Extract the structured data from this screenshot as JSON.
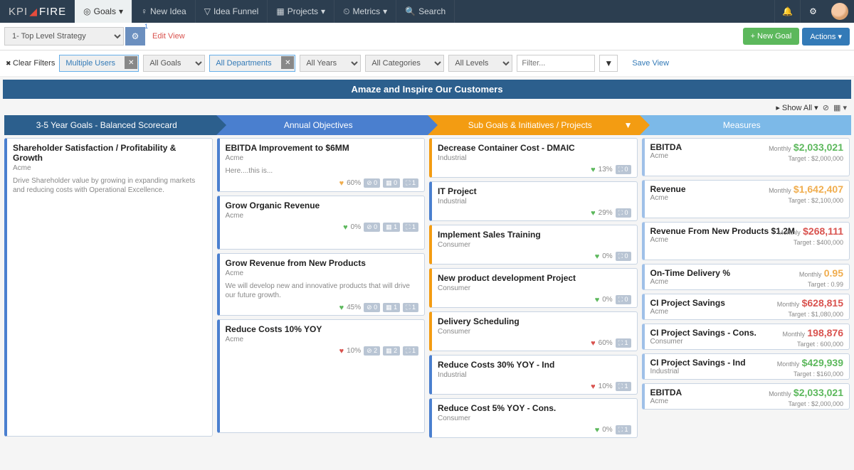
{
  "nav": {
    "logo_a": "KPI",
    "logo_b": "FIRE",
    "items": [
      {
        "label": "Goals",
        "icon": "◎"
      },
      {
        "label": "New Idea",
        "icon": "♀"
      },
      {
        "label": "Idea Funnel",
        "icon": "▽"
      },
      {
        "label": "Projects",
        "icon": "▦"
      },
      {
        "label": "Metrics",
        "icon": "⏲"
      },
      {
        "label": "Search",
        "icon": "🔍"
      }
    ]
  },
  "toolbar": {
    "strategy": "1- Top Level Strategy",
    "badge": "1",
    "edit_view": "Edit View",
    "new_goal": "+ New Goal",
    "actions": "Actions"
  },
  "filters": {
    "clear": "Clear Filters",
    "users": "Multiple Users",
    "goals": "All Goals",
    "depts": "All Departments",
    "years": "All Years",
    "cats": "All Categories",
    "levels": "All Levels",
    "filter_ph": "Filter...",
    "save_view": "Save View"
  },
  "banner": "Amaze and Inspire Our Customers",
  "showall": "Show All",
  "headers": [
    "3-5 Year Goals - Balanced Scorecard",
    "Annual Objectives",
    "Sub Goals & Initiatives / Projects",
    "Measures"
  ],
  "col1": [
    {
      "title": "Shareholder Satisfaction / Profitability & Growth",
      "org": "Acme",
      "desc": "Drive Shareholder value by growing in expanding markets and reducing costs with Operational Excellence."
    }
  ],
  "col2": [
    {
      "title": "EBITDA Improvement to $6MM",
      "org": "Acme",
      "desc": "Here....this is...",
      "heart": "orange",
      "pct": "60%",
      "chips": [
        "⊘ 0",
        "▦ 0",
        "⛶ 1"
      ]
    },
    {
      "title": "Grow Organic Revenue",
      "org": "Acme",
      "heart": "green",
      "pct": "0%",
      "chips": [
        "⊘ 0",
        "▦ 1",
        "⛶ 1"
      ]
    },
    {
      "title": "Grow Revenue from New Products",
      "org": "Acme",
      "desc": "We will develop new and innovative products that will drive our future growth.",
      "heart": "green",
      "pct": "45%",
      "chips": [
        "⊘ 0",
        "▦ 1",
        "⛶ 1"
      ]
    },
    {
      "title": "Reduce Costs 10% YOY",
      "org": "Acme",
      "heart": "red",
      "pct": "10%",
      "chips": [
        "⊘ 2",
        "▦ 2",
        "⛶ 1"
      ],
      "tall": true
    }
  ],
  "col3": [
    {
      "title": "Decrease Container Cost - DMAIC",
      "org": "Industrial",
      "color": "orange",
      "heart": "green",
      "pct": "13%",
      "chips": [
        "⛶ 0"
      ]
    },
    {
      "title": "IT Project",
      "org": "Industrial",
      "heart": "green",
      "pct": "29%",
      "chips": [
        "⛶ 0"
      ]
    },
    {
      "title": "Implement Sales Training",
      "org": "Consumer",
      "color": "orange",
      "heart": "green",
      "pct": "0%",
      "chips": [
        "⛶ 0"
      ],
      "tall": true
    },
    {
      "title": "New product development Project",
      "org": "Consumer",
      "color": "orange",
      "heart": "green",
      "pct": "0%",
      "chips": [
        "⛶ 0"
      ],
      "tall": true
    },
    {
      "title": "Delivery Scheduling",
      "org": "Consumer",
      "color": "orange",
      "heart": "red",
      "pct": "60%",
      "chips": [
        "⛶ 1"
      ]
    },
    {
      "title": "Reduce Costs 30% YOY - Ind",
      "org": "Industrial",
      "heart": "red",
      "pct": "10%",
      "chips": [
        "⛶ 1"
      ]
    },
    {
      "title": "Reduce Cost 5% YOY - Cons.",
      "org": "Consumer",
      "heart": "green",
      "pct": "0%",
      "chips": [
        "⛶ 1"
      ]
    }
  ],
  "col4": [
    {
      "title": "EBITDA",
      "org": "Acme",
      "period": "Monthly",
      "num": "$2,033,021",
      "tgt": "Target : $2,000,000",
      "cls": "green",
      "tall": true
    },
    {
      "title": "Revenue",
      "org": "Acme",
      "period": "Monthly",
      "num": "$1,642,407",
      "tgt": "Target : $2,100,000",
      "cls": "orange",
      "tall": true
    },
    {
      "title": "Revenue From New Products $1.2M",
      "org": "Acme",
      "period": "Monthly",
      "num": "$268,111",
      "tgt": "Target : $400,000",
      "cls": "red",
      "tall": true
    },
    {
      "title": "On-Time Delivery %",
      "org": "Acme",
      "period": "Monthly",
      "num": "0.95",
      "tgt": "Target : 0.99",
      "cls": "orange"
    },
    {
      "title": "CI Project Savings",
      "org": "Acme",
      "period": "Monthly",
      "num": "$628,815",
      "tgt": "Target : $1,080,000",
      "cls": "red"
    },
    {
      "title": "CI Project Savings - Cons.",
      "org": "Consumer",
      "period": "Monthly",
      "num": "198,876",
      "tgt": "Target : 600,000",
      "cls": "red"
    },
    {
      "title": "CI Project Savings - Ind",
      "org": "Industrial",
      "period": "Monthly",
      "num": "$429,939",
      "tgt": "Target : $160,000",
      "cls": "green"
    },
    {
      "title": "EBITDA",
      "org": "Acme",
      "period": "Monthly",
      "num": "$2,033,021",
      "tgt": "Target : $2,000,000",
      "cls": "green"
    }
  ]
}
